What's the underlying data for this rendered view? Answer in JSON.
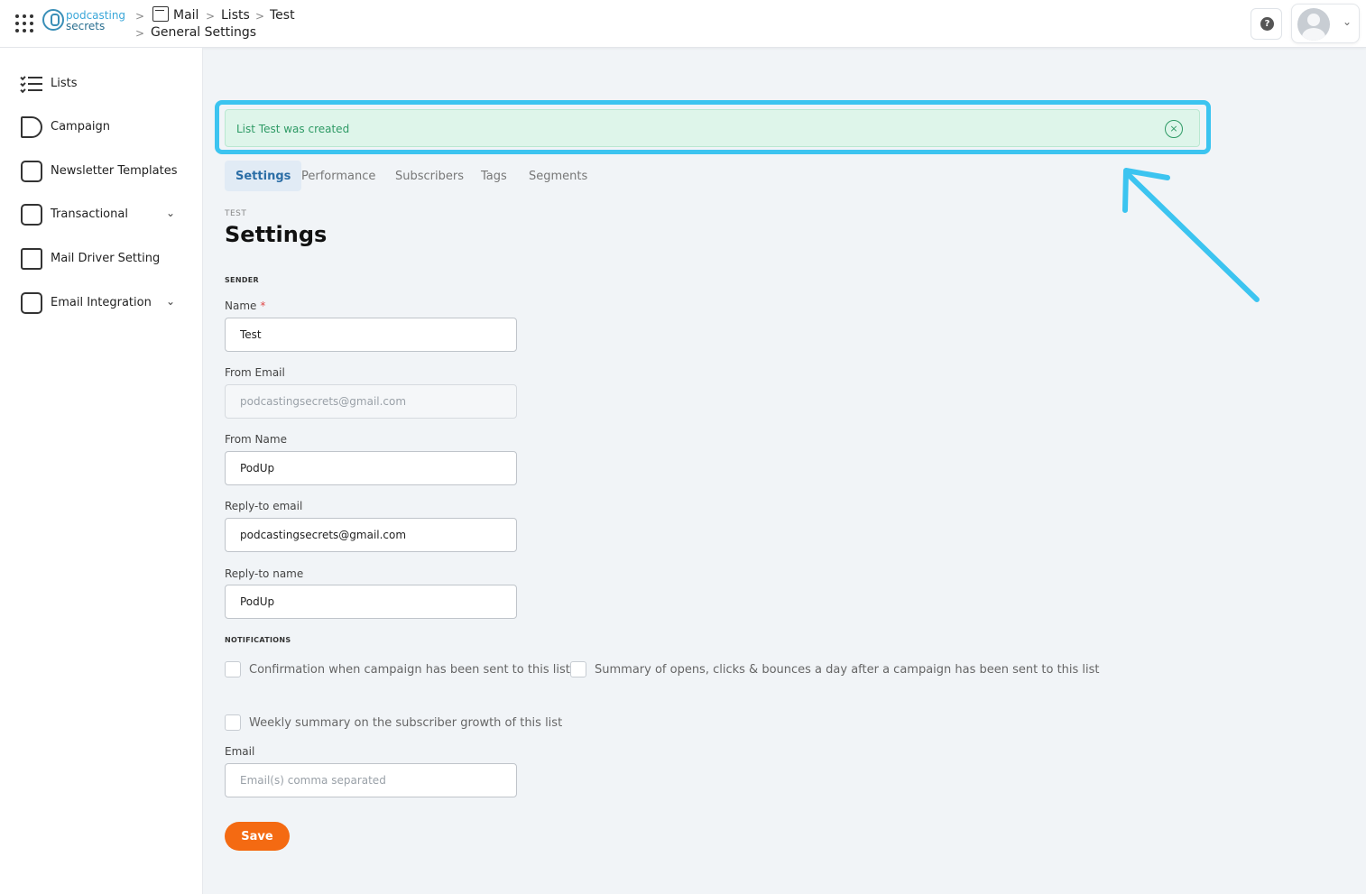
{
  "header": {
    "logo": {
      "line1": "podcasting",
      "line2": "secrets"
    },
    "breadcrumb": {
      "mail": "Mail",
      "lists": "Lists",
      "test": "Test",
      "general_settings": "General Settings"
    },
    "separator": ">",
    "help": "?",
    "user_menu_icon": "chevron-down-icon"
  },
  "sidebar": {
    "items": [
      {
        "label": "Lists",
        "icon": "checklist-icon"
      },
      {
        "label": "Campaign",
        "icon": "megaphone-icon"
      },
      {
        "label": "Newsletter Templates",
        "icon": "newsletter-icon"
      },
      {
        "label": "Transactional",
        "icon": "inbox-icon",
        "expandable": true
      },
      {
        "label": "Mail Driver Setting",
        "icon": "mail-driver-icon"
      },
      {
        "label": "Email Integration",
        "icon": "inbox-icon",
        "expandable": true
      }
    ],
    "chevron": "⌄"
  },
  "alert": {
    "text": "List Test was created",
    "close": "×",
    "color": "#2e9a65"
  },
  "annotation": {
    "highlight_color": "#3cc4f0"
  },
  "tabs": [
    {
      "label": "Settings",
      "active": true
    },
    {
      "label": "Performance",
      "active": false
    },
    {
      "label": "Subscribers",
      "active": false
    },
    {
      "label": "Tags",
      "active": false
    },
    {
      "label": "Segments",
      "active": false
    }
  ],
  "page": {
    "eyebrow": "TEST",
    "title": "Settings"
  },
  "sender": {
    "section_label": "SENDER",
    "name": {
      "label": "Name",
      "required_mark": "*",
      "value": "Test"
    },
    "from_email": {
      "label": "From Email",
      "value": "podcastingsecrets@gmail.com"
    },
    "from_name": {
      "label": "From Name",
      "value": "PodUp"
    },
    "reply_to_email": {
      "label": "Reply-to email",
      "value": "podcastingsecrets@gmail.com"
    },
    "reply_to_name": {
      "label": "Reply-to name",
      "value": "PodUp"
    }
  },
  "notifications": {
    "section_label": "NOTIFICATIONS",
    "options": [
      {
        "label": "Confirmation when campaign has been sent to this list",
        "checked": false
      },
      {
        "label": "Summary of opens, clicks & bounces a day after a campaign has been sent to this list",
        "checked": false
      },
      {
        "label": "Weekly summary on the subscriber growth of this list",
        "checked": false
      }
    ],
    "email": {
      "label": "Email",
      "placeholder": "Email(s) comma separated"
    }
  },
  "actions": {
    "save_label": "Save",
    "save_color": "#f46a12"
  }
}
